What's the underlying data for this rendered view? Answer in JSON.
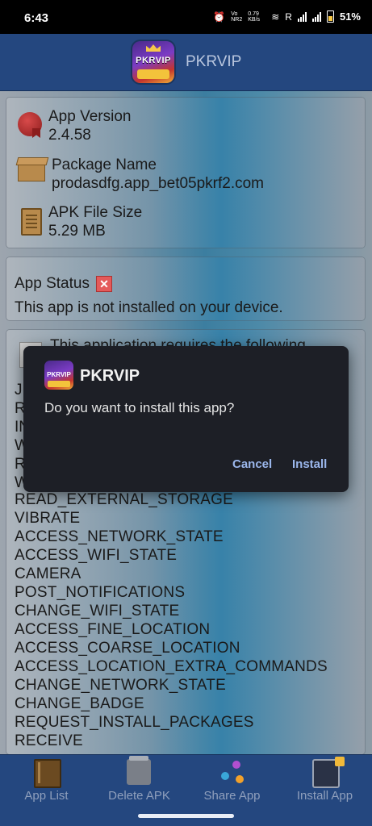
{
  "status_bar": {
    "time": "6:43",
    "network_speed": "0.79 KB/s",
    "network_type": "Vo NR2",
    "roaming": "R",
    "battery": "51%",
    "icons": [
      "alarm-icon",
      "wifi-icon",
      "signal-icon",
      "battery-icon"
    ]
  },
  "app_bar": {
    "title": "PKRVIP",
    "logo_text": "PKRVIP"
  },
  "info": {
    "version_label": "App Version",
    "version_value": "2.4.58",
    "package_label": "Package Name",
    "package_value": "prodasdfg.app_bet05pkrf2.com",
    "size_label": "APK File Size",
    "size_value": "5.29 MB"
  },
  "status": {
    "label": "App Status",
    "message": "This app is not installed on your device."
  },
  "permissions": {
    "header": "This application requires the following",
    "partially_hidden": [
      "J",
      "R",
      "IN",
      "W",
      "R",
      "W"
    ],
    "items": [
      "READ_EXTERNAL_STORAGE",
      "VIBRATE",
      "ACCESS_NETWORK_STATE",
      "ACCESS_WIFI_STATE",
      "CAMERA",
      "POST_NOTIFICATIONS",
      "CHANGE_WIFI_STATE",
      "ACCESS_FINE_LOCATION",
      "ACCESS_COARSE_LOCATION",
      "ACCESS_LOCATION_EXTRA_COMMANDS",
      "CHANGE_NETWORK_STATE",
      "CHANGE_BADGE",
      "REQUEST_INSTALL_PACKAGES",
      "RECEIVE"
    ]
  },
  "dialog": {
    "title": "PKRVIP",
    "message": "Do you want to install this app?",
    "cancel": "Cancel",
    "install": "Install"
  },
  "bottom_nav": {
    "app_list": "App List",
    "delete_apk": "Delete APK",
    "share_app": "Share App",
    "install_app": "Install App"
  },
  "colors": {
    "app_bar": "#24477f",
    "dialog_bg": "#1d1f26",
    "dialog_button": "#9bb7ec"
  }
}
